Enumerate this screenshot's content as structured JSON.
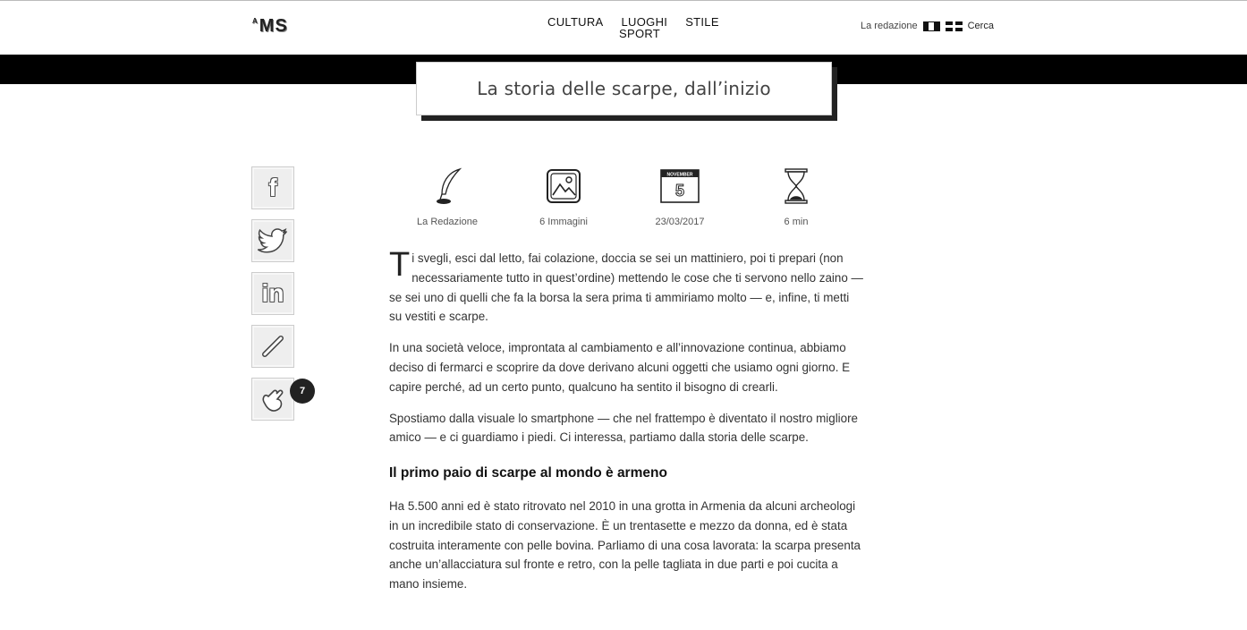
{
  "header": {
    "logo_sup": "A",
    "logo_text": "MS",
    "nav": [
      "CULTURA",
      "LUOGHI",
      "STILE",
      "SPORT"
    ],
    "redazione_link": "La redazione",
    "search_label": "Cerca"
  },
  "article": {
    "title": "La storia delle scarpe, dall’inizio",
    "meta": [
      {
        "icon": "quill-icon",
        "label": "La Redazione"
      },
      {
        "icon": "image-icon",
        "label": "6 Immagini"
      },
      {
        "icon": "calendar-icon",
        "label": "23/03/2017"
      },
      {
        "icon": "hourglass-icon",
        "label": "6 min"
      }
    ],
    "calendar_month": "NOVEMBER",
    "calendar_day": "5",
    "dropcap": "T",
    "p1_rest": "i svegli, esci dal letto, fai colazione, doccia se sei un mattiniero, poi ti prepari (non necessariamente tutto in quest’ordine) mettendo le cose che ti servono nello zaino — se sei uno di quelli che fa la borsa la sera prima ti ammiriamo molto — e, infine, ti metti su vestiti e scarpe.",
    "p2": "In una società veloce, improntata al cambiamento e all’innovazione continua, abbiamo deciso di fermarci e scoprire da dove derivano alcuni oggetti che usiamo ogni giorno. E capire perché, ad un certo punto, qualcuno ha sentito il bisogno di crearli.",
    "p3": "Spostiamo dalla visuale lo smartphone — che nel frattempo è diventato il nostro migliore amico — e ci guardiamo i piedi. Ci interessa, partiamo dalla storia delle scarpe.",
    "h2": "Il primo paio di scarpe al mondo è armeno",
    "p4": "Ha 5.500 anni ed è stato ritrovato nel 2010 in una grotta in Armenia da alcuni archeologi in un incredibile stato di conservazione. È un trentasette e mezzo da donna, ed è stata costruita interamente con pelle bovina. Parliamo di una cosa lavorata: la scarpa presenta anche un’allacciatura sul fronte e retro, con la pelle tagliata in due parti e poi cucita a mano insieme."
  },
  "share": {
    "buttons": [
      {
        "icon": "facebook-icon",
        "glyph": "f"
      },
      {
        "icon": "twitter-icon",
        "glyph": "🐦"
      },
      {
        "icon": "linkedin-icon",
        "glyph": "in"
      },
      {
        "icon": "link-icon",
        "glyph": "🔗"
      },
      {
        "icon": "clap-icon",
        "glyph": "👏"
      }
    ],
    "clap_count": "7"
  },
  "colors": {
    "band": "#000000",
    "text": "#333333",
    "flag_it_left": "#111111",
    "flag_it_mid": "#ffffff",
    "flag_it_right": "#111111"
  }
}
